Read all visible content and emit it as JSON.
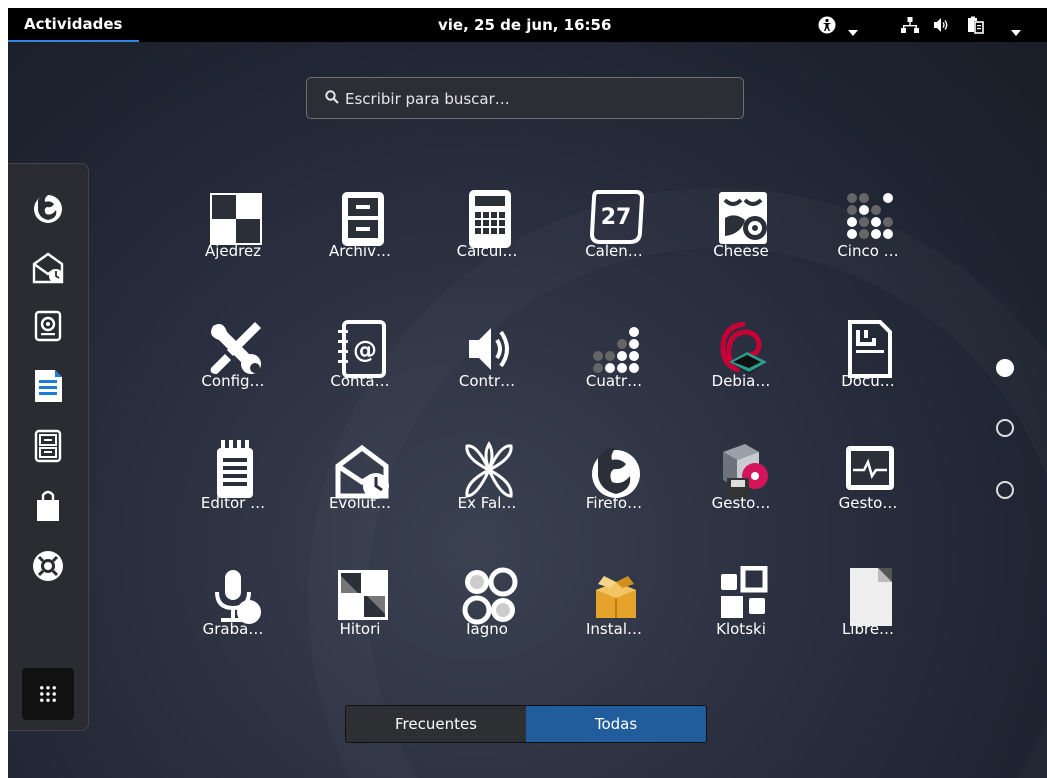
{
  "topbar": {
    "activities": "Actividades",
    "clock": "vie, 25 de jun, 16:56",
    "icons": [
      "accessibility-icon",
      "chevron-down-icon",
      "network-icon",
      "volume-icon",
      "clipboard-icon",
      "chevron-down-icon"
    ]
  },
  "search": {
    "placeholder": "Escribir para buscar…"
  },
  "dash": {
    "items": [
      "firefox",
      "evolution",
      "sound-juicer",
      "libreoffice-writer",
      "file-cabinet",
      "software",
      "help",
      "show-applications"
    ]
  },
  "apps": [
    {
      "label": "Ajedrez",
      "icon": "chess-icon"
    },
    {
      "label": "Archiv…",
      "icon": "archive-icon"
    },
    {
      "label": "Calcul…",
      "icon": "calculator-icon"
    },
    {
      "label": "Calen…",
      "icon": "calendar-icon",
      "number": "27"
    },
    {
      "label": "Cheese",
      "icon": "cheese-icon"
    },
    {
      "label": "Cinco …",
      "icon": "five-dots-icon"
    },
    {
      "label": "Config…",
      "icon": "settings-tools-icon"
    },
    {
      "label": "Conta…",
      "icon": "contacts-icon"
    },
    {
      "label": "Contr…",
      "icon": "volume-control-icon"
    },
    {
      "label": "Cuatr…",
      "icon": "four-in-row-icon"
    },
    {
      "label": "Debia…",
      "icon": "debian-icon"
    },
    {
      "label": "Docu…",
      "icon": "document-viewer-icon"
    },
    {
      "label": "Editor …",
      "icon": "text-editor-icon"
    },
    {
      "label": "Evolut…",
      "icon": "evolution-icon"
    },
    {
      "label": "Ex Fal…",
      "icon": "ex-falso-icon"
    },
    {
      "label": "Firefo…",
      "icon": "firefox-icon"
    },
    {
      "label": "Gesto…",
      "icon": "package-manager-icon"
    },
    {
      "label": "Gesto…",
      "icon": "system-monitor-icon"
    },
    {
      "label": "Graba…",
      "icon": "sound-recorder-icon"
    },
    {
      "label": "Hitori",
      "icon": "hitori-icon"
    },
    {
      "label": "Iagno",
      "icon": "iagno-icon"
    },
    {
      "label": "Instal…",
      "icon": "installer-icon"
    },
    {
      "label": "Klotski",
      "icon": "klotski-icon"
    },
    {
      "label": "Libre…",
      "icon": "libreoffice-icon"
    }
  ],
  "pages": {
    "count": 3,
    "current": 1
  },
  "tabs": {
    "frequent": "Frecuentes",
    "all": "Todas",
    "active": "all"
  },
  "colors": {
    "accent": "#3584e4",
    "tab_active": "#215d9c",
    "topbar": "#000000"
  }
}
